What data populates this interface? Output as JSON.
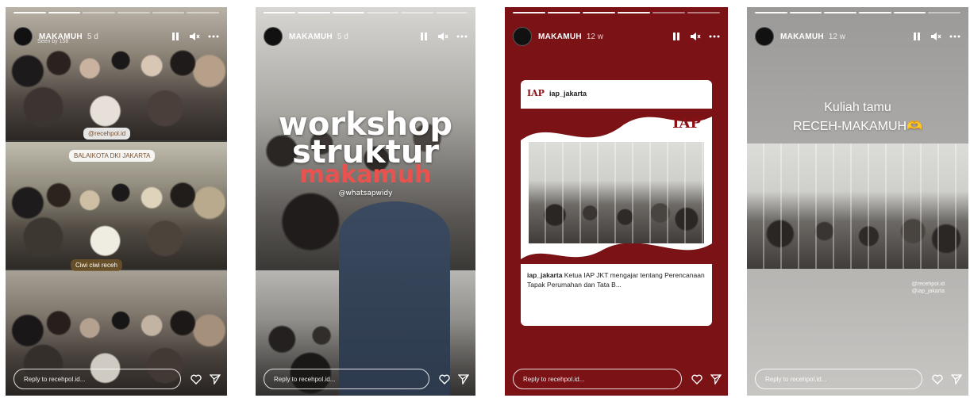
{
  "stories": [
    {
      "username": "MAKAMUH",
      "age": "5 d",
      "subline": "Seen by 158",
      "reply_placeholder": "Reply to recehpol.id...",
      "tags": [
        "@recehpol.id",
        "BALAIKOTA DKI JAKARTA",
        "Ciwi ciwi receh"
      ]
    },
    {
      "username": "MAKAMUH",
      "age": "5 d",
      "reply_placeholder": "Reply to recehpol.id...",
      "title_line1": "workshop",
      "title_line2": "struktur",
      "title_line3": "makamuh",
      "mention": "@whatsapwidy"
    },
    {
      "username": "MAKAMUH",
      "age": "12 w",
      "reply_placeholder": "Reply to recehpol.id...",
      "card_logo": "IAP",
      "card_user": "iap_jakarta",
      "card_badge": "IAP",
      "caption_user": "iap_jakarta",
      "caption_text": "Ketua IAP JKT mengajar tentang Perencanaan Tapak Perumahan dan Tata B..."
    },
    {
      "username": "MAKAMUH",
      "age": "12 w",
      "reply_placeholder": "Reply to recehpol.id...",
      "title_line1": "Kuliah tamu",
      "title_line2": "RECEH-MAKAMUH🫶",
      "caption_line1": "@recehpol.id",
      "caption_line2": "@iap_jakarta"
    }
  ],
  "icons": {
    "pause": "pause-icon",
    "mute": "mute-icon",
    "more": "more-icon",
    "heart": "heart-icon",
    "send": "send-icon"
  }
}
